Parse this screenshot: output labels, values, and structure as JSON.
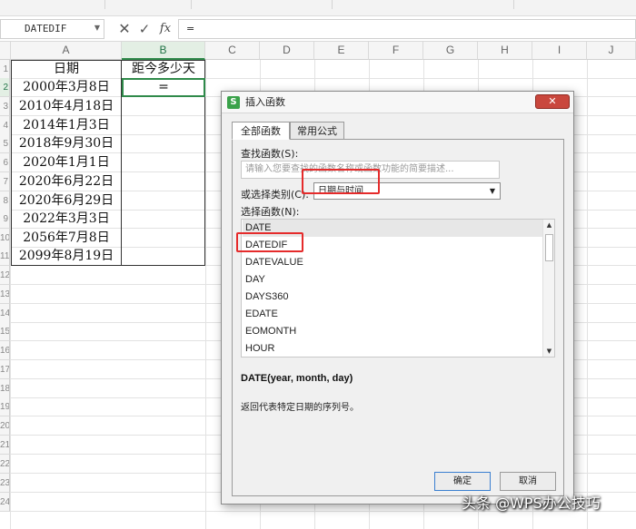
{
  "formula_bar": {
    "name_box": "DATEDIF",
    "cancel_glyph": "✕",
    "enter_glyph": "✓",
    "fx_label": "fx",
    "formula": "="
  },
  "columns": [
    "A",
    "B",
    "C",
    "D",
    "E",
    "F",
    "G",
    "H",
    "I",
    "J"
  ],
  "rows": [
    "1",
    "2",
    "3",
    "4",
    "5",
    "6",
    "7",
    "8",
    "9",
    "10",
    "11",
    "12",
    "13",
    "14",
    "15",
    "16",
    "17",
    "18",
    "19",
    "20",
    "21",
    "22",
    "23",
    "24"
  ],
  "sheet": {
    "header_a": "日期",
    "header_b": "距今多少天",
    "b2_value": "=",
    "dates": [
      "2000年3月8日",
      "2010年4月18日",
      "2014年1月3日",
      "2018年9月30日",
      "2020年1月1日",
      "2020年6月22日",
      "2020年6月29日",
      "2022年3月3日",
      "2056年7月8日",
      "2099年8月19日"
    ]
  },
  "dialog": {
    "icon_glyph": "S",
    "title": "插入函数",
    "close_glyph": "✕",
    "tabs": [
      "全部函数",
      "常用公式"
    ],
    "search_label": "查找函数(S):",
    "search_placeholder": "请输入您要查找的函数名称或函数功能的简要描述...",
    "category_label": "或选择类别(C):",
    "category_value": "日期与时间",
    "dropdown_glyph": "▼",
    "function_list_label": "选择函数(N):",
    "functions": [
      "DATE",
      "DATEDIF",
      "DATEVALUE",
      "DAY",
      "DAYS360",
      "EDATE",
      "EOMONTH",
      "HOUR"
    ],
    "scroll_up_glyph": "▲",
    "scroll_down_glyph": "▼",
    "signature": "DATE(year, month, day)",
    "description": "返回代表特定日期的序列号。",
    "ok_label": "确定",
    "cancel_label": "取消"
  },
  "watermark": "头条 @WPS办公技巧",
  "colors": {
    "highlight": "#e52b2b",
    "active_cell": "#2f8a4a",
    "close_button": "#c9473d"
  }
}
